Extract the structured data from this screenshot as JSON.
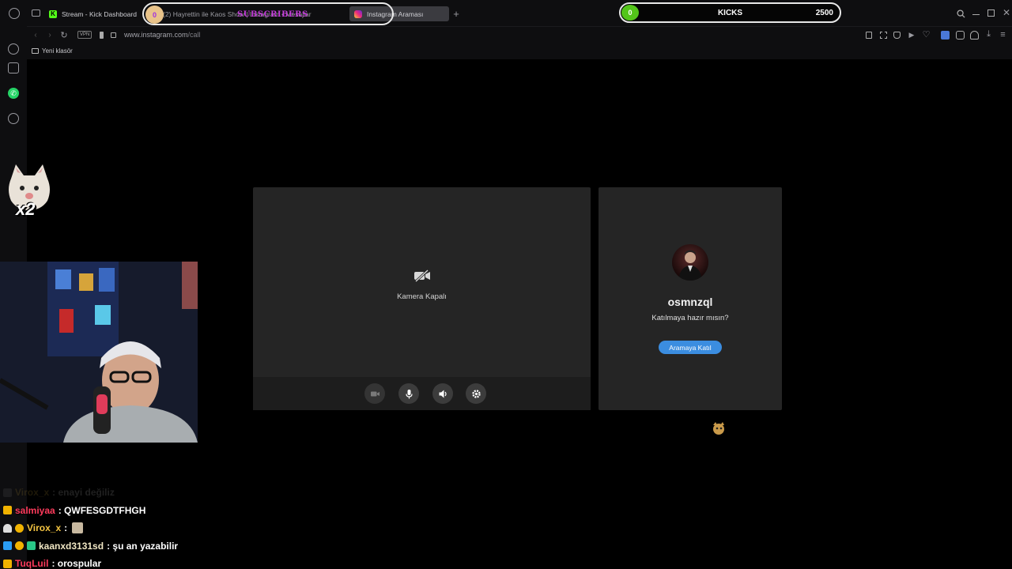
{
  "browser": {
    "tabs": [
      {
        "label": "Stream - Kick Dashboard"
      },
      {
        "label": "(2) Hayrettin ile Kaos Show | Instagram • Mesajlar"
      },
      {
        "label": "Instagram Araması"
      }
    ],
    "new_tab_label": "+",
    "vpn_label": "VPN",
    "url_host": "www.instagram.com",
    "url_path": "/call",
    "bookmark_folder": "Yeni klasör",
    "accent": "#3b8de0"
  },
  "overlays": {
    "subscribers": {
      "count": "0",
      "label": "SUBSCRIBERS"
    },
    "kicks": {
      "count": "0",
      "label": "KICKS",
      "goal": "2500",
      "color": "#53c51a"
    },
    "cat_multiplier": "x2"
  },
  "call": {
    "camera_off_label": "Kamera Kapalı",
    "username": "osmnzql",
    "ready_prompt": "Katılmaya hazır mısın?",
    "join_button": "Aramaya Katıl",
    "controls": [
      "video-icon",
      "mic-icon",
      "speaker-icon",
      "settings-icon"
    ]
  },
  "chat": [
    {
      "user": "Virox_x",
      "message": ": enayi değiliz",
      "color": "#f5c542",
      "faded": true
    },
    {
      "user": "salmiyaa",
      "message": ": QWFESGDTFHGH",
      "color": "#ff3b5c",
      "faded": false
    },
    {
      "user": "Virox_x",
      "message": ":",
      "color": "#f5c542",
      "faded": false
    },
    {
      "user": "kaanxd3131sd",
      "message": ": şu an yazabilir",
      "color": "#f1e7c4",
      "faded": false
    },
    {
      "user": "TuqLuil",
      "message": ": orospular",
      "color": "#ff3b5c",
      "faded": false
    }
  ]
}
